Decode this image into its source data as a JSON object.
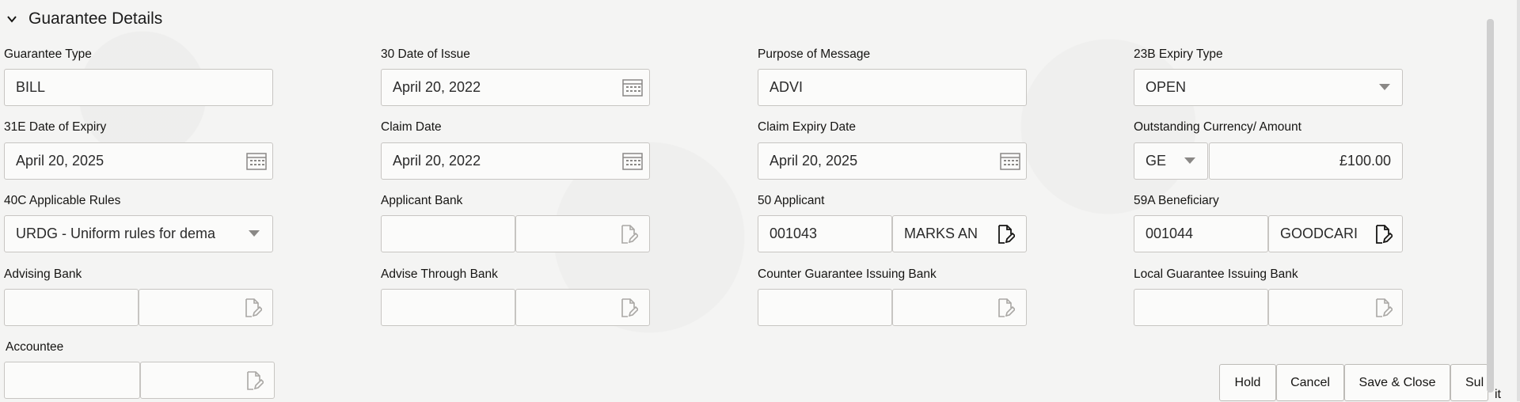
{
  "section": {
    "title": "Guarantee Details"
  },
  "fields": {
    "guarantee_type": {
      "label": "Guarantee Type",
      "value": "BILL"
    },
    "date_of_issue": {
      "label": "30 Date of Issue",
      "value": "April 20, 2022"
    },
    "purpose_of_message": {
      "label": "Purpose of Message",
      "value": "ADVI"
    },
    "expiry_type": {
      "label": "23B Expiry Type",
      "value": "OPEN"
    },
    "date_of_expiry": {
      "label": "31E Date of Expiry",
      "value": "April 20, 2025"
    },
    "claim_date": {
      "label": "Claim Date",
      "value": "April 20, 2022"
    },
    "claim_expiry_date": {
      "label": "Claim Expiry Date",
      "value": "April 20, 2025"
    },
    "outstanding": {
      "label": "Outstanding Currency/ Amount",
      "currency": "GE",
      "amount": "£100.00"
    },
    "applicable_rules": {
      "label": "40C Applicable Rules",
      "value": "URDG - Uniform rules for dema"
    },
    "applicant_bank": {
      "label": "Applicant Bank",
      "code": "",
      "name": ""
    },
    "applicant": {
      "label": "50 Applicant",
      "code": "001043",
      "name": "MARKS AN"
    },
    "beneficiary": {
      "label": "59A Beneficiary",
      "code": "001044",
      "name": "GOODCARI"
    },
    "advising_bank": {
      "label": "Advising Bank",
      "code": "",
      "name": ""
    },
    "advise_through_bank": {
      "label": "Advise Through Bank",
      "code": "",
      "name": ""
    },
    "counter_guarantee_bank": {
      "label": "Counter Guarantee Issuing Bank",
      "code": "",
      "name": ""
    },
    "local_guarantee_bank": {
      "label": "Local Guarantee Issuing Bank",
      "code": "",
      "name": ""
    },
    "accountee": {
      "label": "Accountee",
      "code": "",
      "name": ""
    }
  },
  "footer": {
    "hold": "Hold",
    "cancel": "Cancel",
    "save_close": "Save & Close",
    "submit": "Sul",
    "exit_fragment": "it"
  },
  "icons": {
    "calendar": "calendar-icon",
    "lookup": "lookup-icon",
    "dropdown": "chevron-down-icon"
  },
  "colors": {
    "border": "#c7c5c2",
    "text": "#161513",
    "background": "#f4f4f3"
  }
}
